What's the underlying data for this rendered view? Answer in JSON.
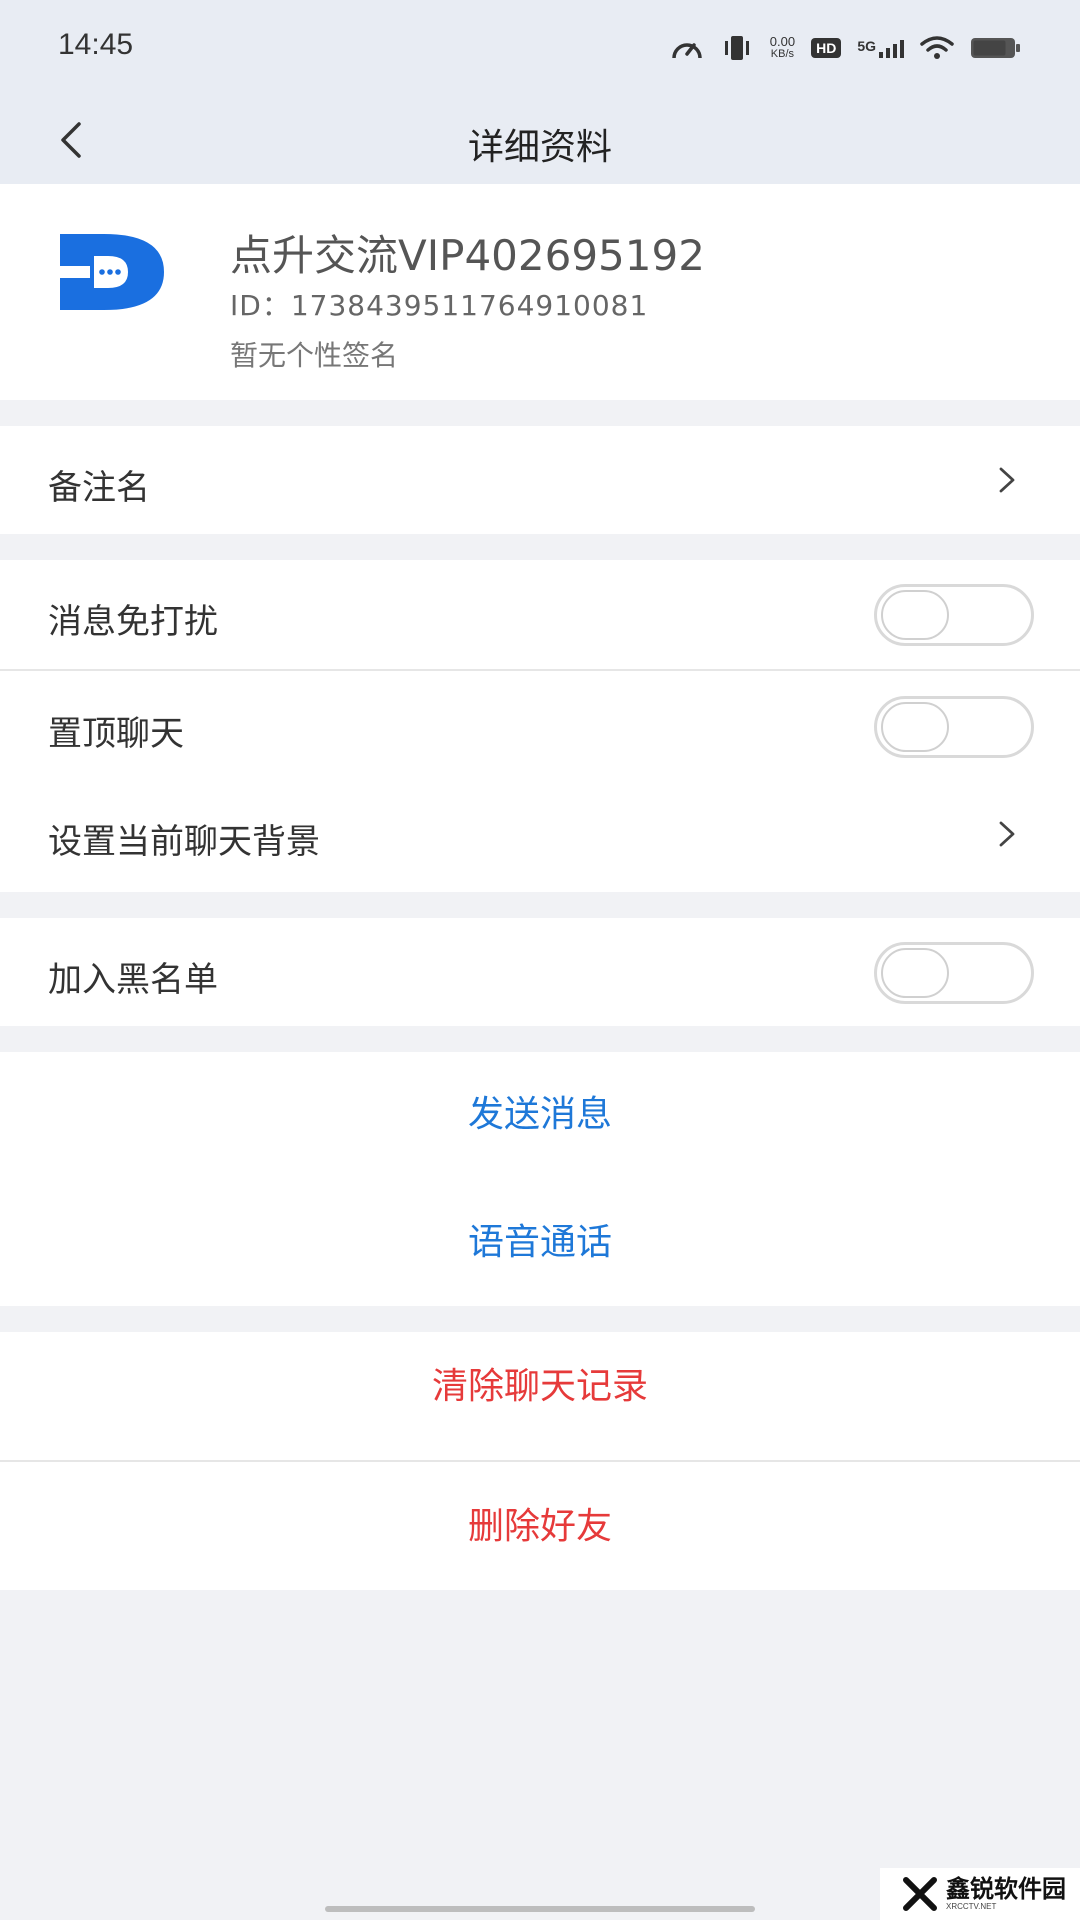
{
  "status_bar": {
    "time": "14:45",
    "net_speed_value": "0.00",
    "net_speed_unit": "KB/s",
    "hd_badge": "HD",
    "network": "5G",
    "icons": [
      "speedometer-icon",
      "vibrate-icon",
      "signal-icon",
      "wifi-icon",
      "battery-icon"
    ]
  },
  "header": {
    "back_icon": "chevron-left-icon",
    "title": "详细资料"
  },
  "profile": {
    "name": "点升交流VIP402695192",
    "id": "ID：1738439511764910081",
    "signature": "暂无个性签名",
    "avatar_colors": {
      "primary": "#1a6fe0",
      "light": "#ffffff"
    }
  },
  "settings": {
    "remark": {
      "label": "备注名"
    },
    "mute": {
      "label": "消息免打扰",
      "on": false
    },
    "pin": {
      "label": "置顶聊天",
      "on": false
    },
    "background": {
      "label": "设置当前聊天背景"
    },
    "blacklist": {
      "label": "加入黑名单",
      "on": false
    }
  },
  "actions": {
    "send_message": "发送消息",
    "voice_call": "语音通话",
    "clear_history": "清除聊天记录",
    "delete_friend": "删除好友"
  },
  "colors": {
    "accent_blue": "#1e78d8",
    "danger_red": "#e63a3a",
    "page_bg": "#f1f2f5",
    "header_bg": "#e8ecf3"
  },
  "watermark": {
    "text": "鑫锐软件园",
    "small": "XRCCTV.NET"
  }
}
